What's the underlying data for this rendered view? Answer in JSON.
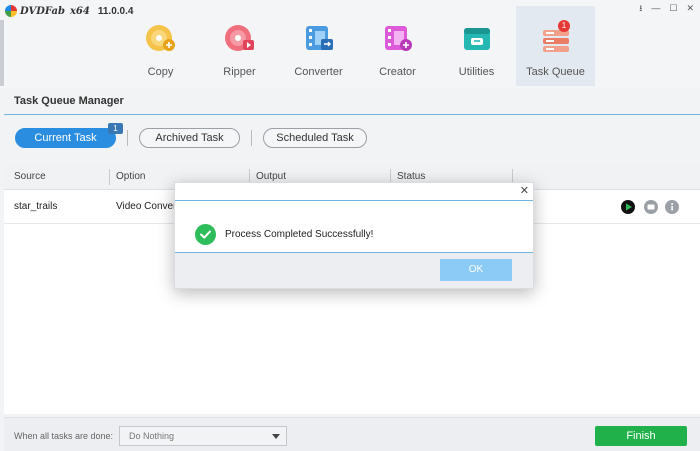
{
  "app": {
    "brand": "DVDFab",
    "arch": "x64",
    "version": "11.0.0.4"
  },
  "window_controls": [
    "⭳",
    "—",
    "☐",
    "✕"
  ],
  "nav": [
    {
      "label": "Copy",
      "icon": "copy-disc-icon",
      "color": "#f0b429"
    },
    {
      "label": "Ripper",
      "icon": "ripper-disc-icon",
      "color": "#ec5c6c"
    },
    {
      "label": "Converter",
      "icon": "converter-film-icon",
      "color": "#3a8fd8"
    },
    {
      "label": "Creator",
      "icon": "creator-film-icon",
      "color": "#d94bd6"
    },
    {
      "label": "Utilities",
      "icon": "utilities-toolbox-icon",
      "color": "#23b6b0"
    },
    {
      "label": "Task Queue",
      "icon": "task-queue-stack-icon",
      "color": "#e8856e",
      "badge": "1",
      "active": true
    }
  ],
  "manager": {
    "title": "Task Queue Manager"
  },
  "tabs": {
    "current": {
      "label": "Current Task",
      "count": "1"
    },
    "archived": {
      "label": "Archived Task"
    },
    "scheduled": {
      "label": "Scheduled Task"
    }
  },
  "table": {
    "columns": [
      "Source",
      "Option",
      "Output",
      "Status"
    ],
    "rows": [
      {
        "source": "star_trails",
        "option": "Video Converter"
      }
    ]
  },
  "footer": {
    "when_label": "When all tasks are done:",
    "select_value": "Do Nothing",
    "finish_label": "Finish"
  },
  "dialog": {
    "message": "Process Completed Successfully!",
    "ok_label": "OK"
  },
  "colors": {
    "accent": "#2a8de0",
    "finish": "#21b14a",
    "success": "#2ebd5b",
    "ok_button": "#8ccbf6"
  }
}
